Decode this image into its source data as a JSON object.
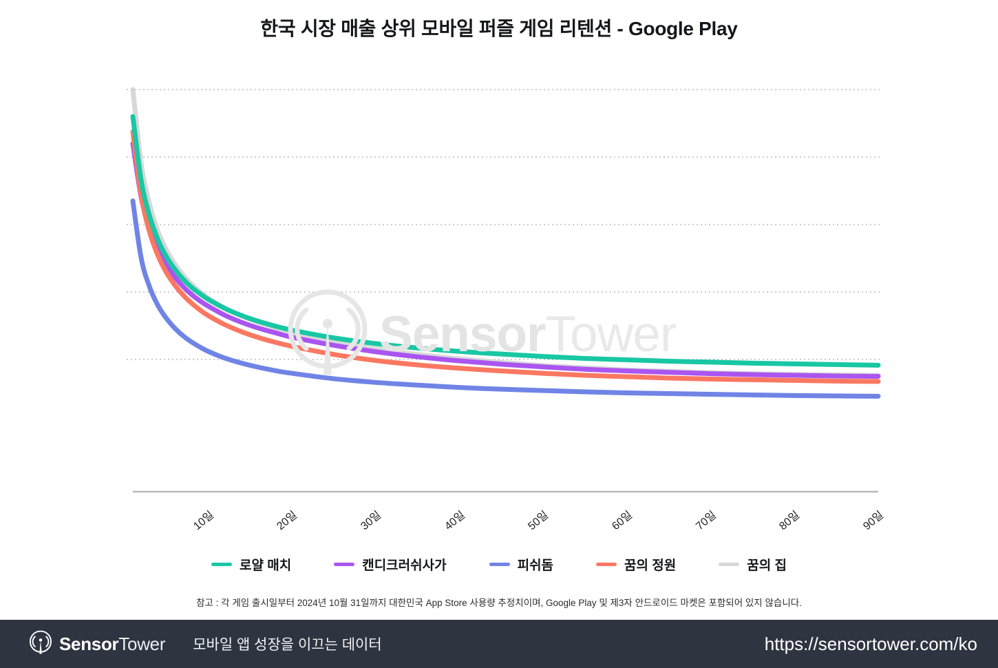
{
  "header": {
    "title": "한국 시장 매출 상위 모바일 퍼즐 게임 리텐션 - Google Play"
  },
  "watermark": {
    "bold": "Sensor",
    "light": "Tower",
    "logo_icon": "sensortower-antenna-icon"
  },
  "footnote": {
    "text": "참고 : 각 게임 출시일부터 2024년 10월 31일까지 대한민국 App Store 사용량 추정치이며, Google Play 및 제3자 안드로이드 마켓은 포함되어 있지 않습니다."
  },
  "footer": {
    "logo_icon": "sensortower-antenna-icon",
    "brand_bold": "Sensor",
    "brand_light": "Tower",
    "tagline": "모바일 앱 성장을 이끄는 데이터",
    "url": "https://sensortower.com/ko"
  },
  "legend": {
    "items": [
      {
        "label": "로얄 매치",
        "color": "#18C7A4"
      },
      {
        "label": "캔디크러쉬사가",
        "color": "#AA55F0"
      },
      {
        "label": "피쉬돔",
        "color": "#7084E6"
      },
      {
        "label": "꿈의 정원",
        "color": "#FA7862"
      },
      {
        "label": "꿈의 집",
        "color": "#D7D7D7"
      }
    ]
  },
  "chart_data": {
    "type": "line",
    "title": "한국 시장 매출 상위 모바일 퍼즐 게임 리텐션 - Google Play",
    "xlabel": "",
    "ylabel": "",
    "grid": true,
    "gridlines_y": [
      100,
      80,
      60,
      40,
      20
    ],
    "ylim": [
      0,
      120
    ],
    "xlim": [
      1,
      90
    ],
    "legend_position": "bottom",
    "xtick_labels": [
      "10일",
      "20일",
      "30일",
      "40일",
      "50일",
      "60일",
      "70일",
      "80일",
      "90일"
    ],
    "xticks": [
      10,
      20,
      30,
      40,
      50,
      60,
      70,
      80,
      90
    ],
    "x": [
      1,
      2,
      3,
      4,
      5,
      6,
      7,
      8,
      9,
      10,
      12,
      14,
      16,
      18,
      20,
      25,
      30,
      35,
      40,
      45,
      50,
      55,
      60,
      65,
      70,
      75,
      80,
      85,
      90
    ],
    "series": [
      {
        "name": "로얄 매치",
        "color": "#18C7A4",
        "values": [
          92.0,
          73.0,
          62.5,
          55.5,
          50.5,
          46.8,
          43.8,
          41.4,
          39.5,
          37.8,
          35.1,
          33.0,
          31.3,
          29.9,
          28.7,
          26.4,
          24.7,
          23.4,
          22.4,
          21.6,
          20.9,
          20.3,
          19.9,
          19.5,
          19.2,
          18.9,
          18.7,
          18.5,
          18.3
        ]
      },
      {
        "name": "캔디크러쉬사가",
        "color": "#AA55F0",
        "values": [
          84.0,
          68.0,
          58.8,
          52.5,
          48.0,
          44.5,
          41.6,
          39.3,
          37.4,
          35.8,
          33.1,
          31.0,
          29.3,
          27.9,
          26.6,
          24.2,
          22.3,
          20.8,
          19.6,
          18.6,
          17.8,
          17.1,
          16.6,
          16.2,
          15.8,
          15.5,
          15.3,
          15.1,
          15.0
        ]
      },
      {
        "name": "피쉬돔",
        "color": "#7084E6",
        "values": [
          67.0,
          50.0,
          41.5,
          36.0,
          32.2,
          29.3,
          27.0,
          25.2,
          23.7,
          22.4,
          20.4,
          18.9,
          17.7,
          16.7,
          15.9,
          14.3,
          13.2,
          12.4,
          11.7,
          11.2,
          10.8,
          10.4,
          10.1,
          9.9,
          9.7,
          9.5,
          9.3,
          9.2,
          9.1
        ]
      },
      {
        "name": "꿈의 정원",
        "color": "#FA7862",
        "values": [
          87.5,
          68.5,
          57.8,
          50.8,
          45.8,
          42.1,
          39.1,
          36.7,
          34.7,
          33.0,
          30.3,
          28.2,
          26.5,
          25.1,
          23.9,
          21.5,
          19.7,
          18.4,
          17.4,
          16.6,
          15.9,
          15.3,
          14.9,
          14.5,
          14.2,
          14.0,
          13.8,
          13.6,
          13.5
        ]
      },
      {
        "name": "꿈의 집",
        "color": "#D7D7D7",
        "values": [
          100.0,
          78.0,
          66.0,
          58.0,
          52.5,
          48.3,
          45.0,
          42.3,
          40.1,
          38.2,
          35.2,
          32.9,
          31.0,
          29.4,
          28.0,
          25.2,
          23.1,
          21.5,
          20.2,
          19.1,
          18.2,
          17.5,
          16.9,
          16.5,
          16.1,
          15.8,
          15.6,
          15.4,
          15.3
        ]
      }
    ]
  }
}
